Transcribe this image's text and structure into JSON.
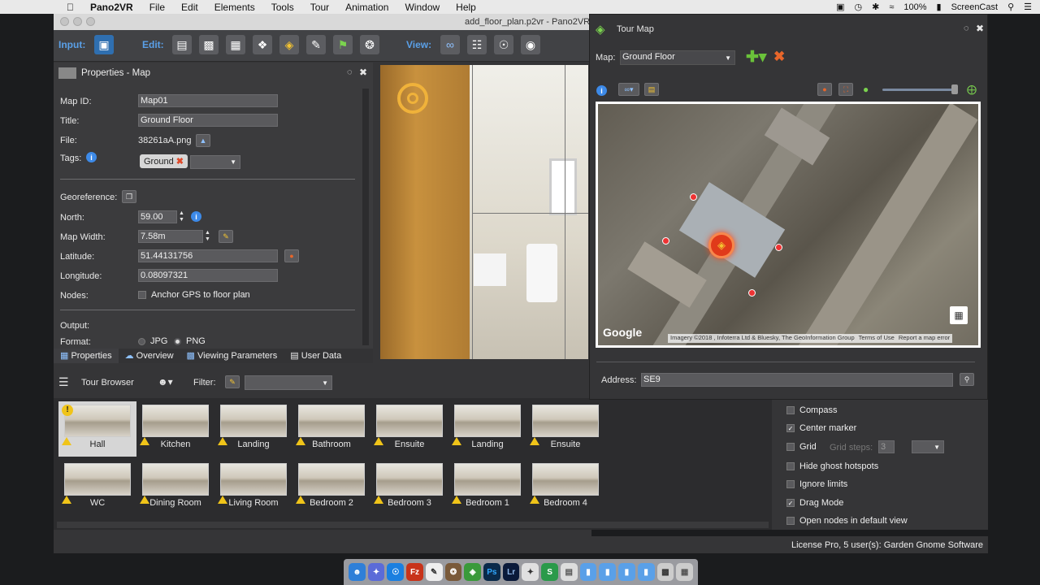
{
  "menubar": {
    "apple": "",
    "app": "Pano2VR",
    "items": [
      "File",
      "Edit",
      "Elements",
      "Tools",
      "Tour",
      "Animation",
      "Window",
      "Help"
    ],
    "battery": "100%",
    "app_right": "ScreenCast"
  },
  "window": {
    "title": "add_floor_plan.p2vr - Pano2VR"
  },
  "toolbar": {
    "input_label": "Input:",
    "edit_label": "Edit:",
    "view_label": "View:"
  },
  "properties": {
    "title": "Properties - Map",
    "map_id_label": "Map ID:",
    "map_id": "Map01",
    "title_label": "Title:",
    "title_value": "Ground Floor",
    "file_label": "File:",
    "file_value": "38261aA.png",
    "tags_label": "Tags:",
    "tag": "Ground",
    "georef_label": "Georeference:",
    "north_label": "North:",
    "north": "59.00",
    "mapwidth_label": "Map Width:",
    "mapwidth": "7.58m",
    "lat_label": "Latitude:",
    "lat": "51.44131756",
    "lon_label": "Longitude:",
    "lon": "0.08097321",
    "nodes_label": "Nodes:",
    "anchor_label": "Anchor GPS to floor plan",
    "output_label": "Output:",
    "format_label": "Format:",
    "fmt_jpg": "JPG",
    "fmt_png": "PNG"
  },
  "tabs": [
    "Properties",
    "Overview",
    "Viewing Parameters",
    "User Data"
  ],
  "tour_browser": {
    "title": "Tour Browser",
    "filter_label": "Filter:"
  },
  "nodes": [
    {
      "name": "Hall",
      "selected": true
    },
    {
      "name": "Kitchen"
    },
    {
      "name": "Landing"
    },
    {
      "name": "Bathroom"
    },
    {
      "name": "Ensuite"
    },
    {
      "name": "Landing"
    },
    {
      "name": "Ensuite"
    },
    {
      "name": "WC"
    },
    {
      "name": "Dining Room"
    },
    {
      "name": "Living Room"
    },
    {
      "name": "Bedroom 2"
    },
    {
      "name": "Bedroom 3"
    },
    {
      "name": "Bedroom 1"
    },
    {
      "name": "Bedroom 4"
    }
  ],
  "options": [
    {
      "label": "Compass",
      "checked": false
    },
    {
      "label": "Center marker",
      "checked": true
    },
    {
      "label": "Grid",
      "checked": false
    },
    {
      "label": "Hide ghost hotspots",
      "checked": false
    },
    {
      "label": "Ignore limits",
      "checked": false
    },
    {
      "label": "Drag Mode",
      "checked": true
    },
    {
      "label": "Open nodes in default view",
      "checked": false
    }
  ],
  "grid_steps_label": "Grid steps:",
  "grid_steps_value": "3",
  "status": "License Pro, 5 user(s): Garden Gnome Software",
  "tour_map": {
    "title": "Tour Map",
    "map_label": "Map:",
    "map_value": "Ground Floor",
    "google": "Google",
    "attribution": "Imagery ©2018 , Infoterra Ltd & Bluesky, The GeoInformation Group",
    "terms": "Terms of Use",
    "report": "Report a map error",
    "address_label": "Address:",
    "address_value": "SE9"
  }
}
